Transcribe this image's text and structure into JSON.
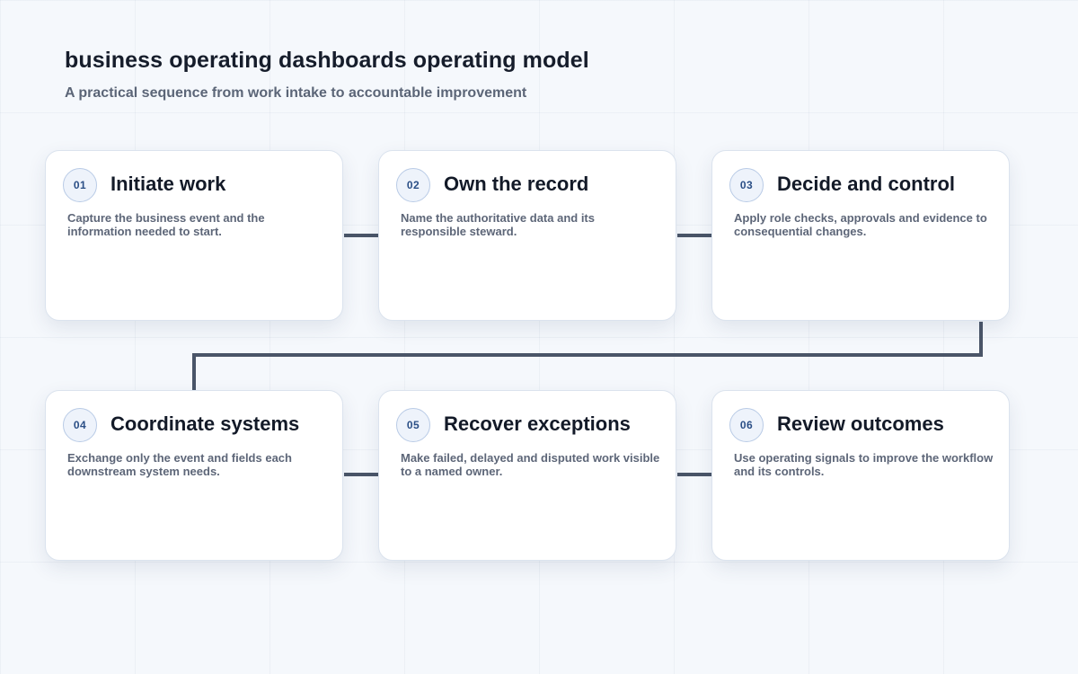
{
  "header": {
    "title": "business operating dashboards operating model",
    "subtitle": "A practical sequence from work intake to accountable improvement"
  },
  "colors": {
    "connector": "#4a5568",
    "badge_text": "#2b4f86",
    "badge_border": "#b9cbe6",
    "card_border": "#dbe3ee",
    "title_text": "#131a28",
    "desc_text": "#5d6678"
  },
  "steps": [
    {
      "number": "01",
      "title": "Initiate work",
      "description": "Capture the business event and the information needed to start."
    },
    {
      "number": "02",
      "title": "Own the record",
      "description": "Name the authoritative data and its responsible steward."
    },
    {
      "number": "03",
      "title": "Decide and control",
      "description": "Apply role checks, approvals and evidence to consequential changes."
    },
    {
      "number": "04",
      "title": "Coordinate systems",
      "description": "Exchange only the event and fields each downstream system needs."
    },
    {
      "number": "05",
      "title": "Recover exceptions",
      "description": "Make failed, delayed and disputed work visible to a named owner."
    },
    {
      "number": "06",
      "title": "Review outcomes",
      "description": "Use operating signals to improve the workflow and its controls."
    }
  ]
}
